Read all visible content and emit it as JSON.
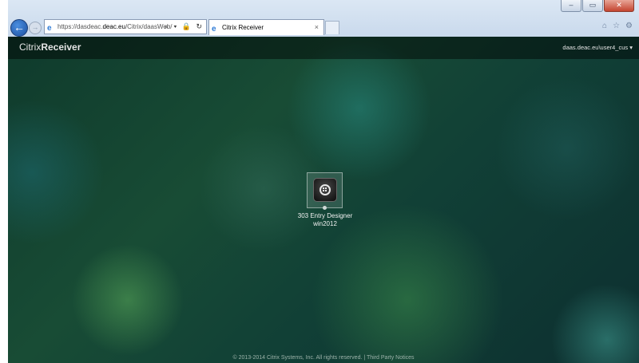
{
  "browser": {
    "url_prefix": "https://dasdeac.",
    "url_domain": "deac.eu",
    "url_path": "/Citrix/daasWeb/",
    "address_tools": "⌕ ▾ 🔒 ↻",
    "tab_title": "Citrix Receiver",
    "tab_close": "×",
    "window_controls": {
      "minimize": "–",
      "maximize": "▭",
      "close": "✕"
    },
    "chrome_icons": [
      "home-icon",
      "star-icon",
      "gear-icon"
    ]
  },
  "receiver": {
    "brand_light": "Citrix",
    "brand_bold": "Receiver",
    "user": "daas.deac.eu\\user4_cus ▾"
  },
  "apps": [
    {
      "name": "303 Entry Designer",
      "sub": "win2012",
      "icon": "windows-app-icon"
    }
  ],
  "footer": {
    "text": "© 2013-2014 Citrix Systems, Inc. All rights reserved.  |  Third Party Notices"
  },
  "colors": {
    "page_background": "#184c35",
    "bar_background": "rgba(0,0,0,0.45)"
  }
}
